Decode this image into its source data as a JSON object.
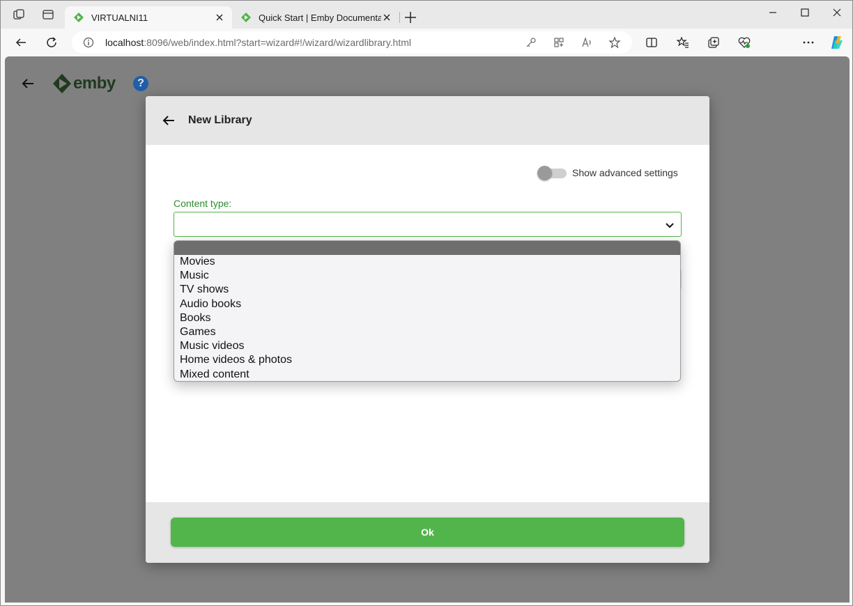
{
  "browser": {
    "tabs": [
      {
        "title": "VIRTUALNI11",
        "active": true
      },
      {
        "title": "Quick Start | Emby Documentatio",
        "active": false
      }
    ],
    "address": {
      "host": "localhost",
      "path": ":8096/web/index.html?start=wizard#!/wizard/wizardlibrary.html"
    }
  },
  "app": {
    "logo_text": "emby",
    "help_label": "?"
  },
  "dialog": {
    "title": "New Library",
    "advanced_toggle_label": "Show advanced settings",
    "advanced_toggle_on": false,
    "content_type_label": "Content type:",
    "content_type_value": "",
    "content_type_options": [
      "",
      "Movies",
      "Music",
      "TV shows",
      "Audio books",
      "Books",
      "Games",
      "Music videos",
      "Home videos & photos",
      "Mixed content"
    ],
    "ok_label": "Ok"
  },
  "colors": {
    "accent": "#52b54b",
    "overlay": "#808080",
    "help_blue": "#1f5fa8"
  }
}
